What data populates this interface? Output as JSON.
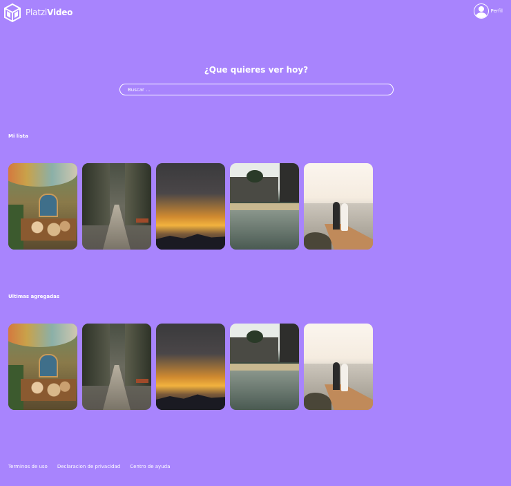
{
  "header": {
    "logo_text_light": "Platzi",
    "logo_text_bold": "Video",
    "profile_label": "Perfil"
  },
  "search": {
    "title": "¿Que quieres ver hoy?",
    "placeholder": "Buscar ..."
  },
  "sections": [
    {
      "title": "Mi lista",
      "items": [
        "market",
        "street",
        "sunset",
        "lake",
        "pier"
      ]
    },
    {
      "title": "Ultimas agregadas",
      "items": [
        "market",
        "street",
        "sunset",
        "lake",
        "pier"
      ]
    }
  ],
  "footer": {
    "links": [
      "Terminos de uso",
      "Declaracion de privacidad",
      "Centro de ayuda"
    ]
  },
  "colors": {
    "background": "#a884fd",
    "text": "#ffffff"
  }
}
